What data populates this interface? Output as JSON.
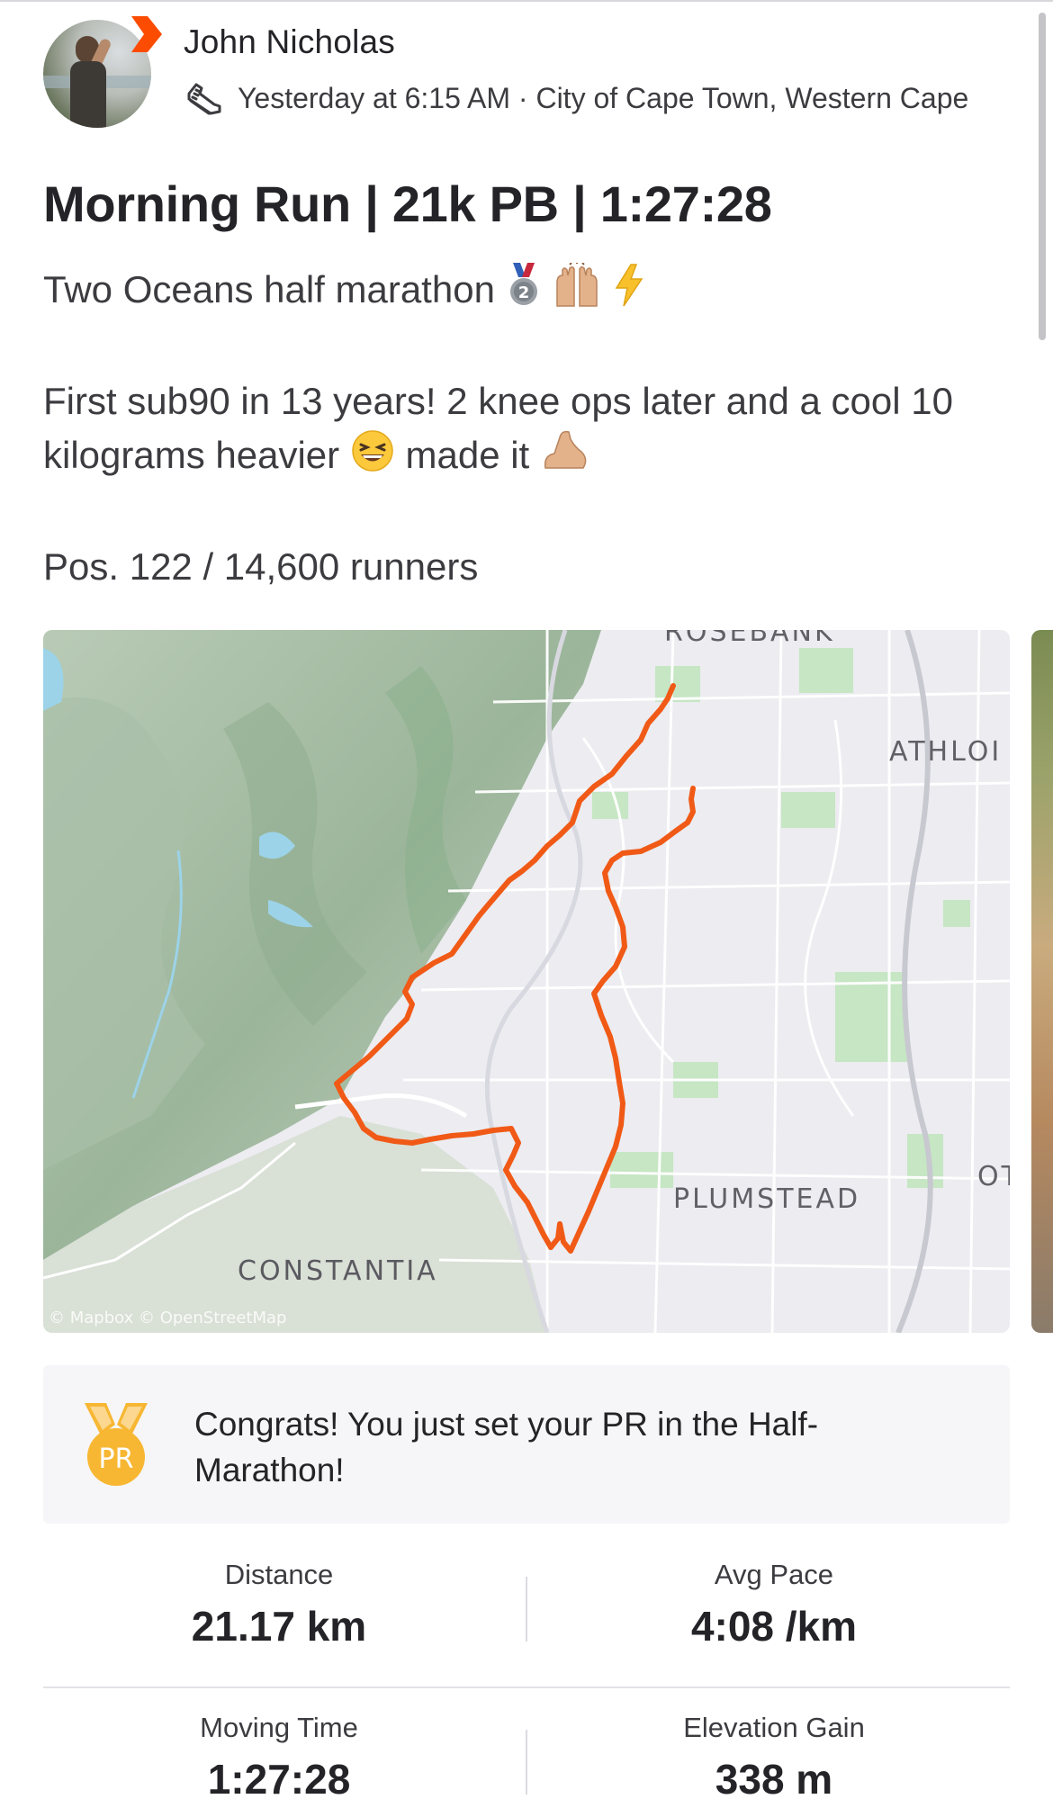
{
  "colors": {
    "accent": "#fc4c02",
    "route": "#f05a16",
    "medal": "#f7b733",
    "text": "#242428"
  },
  "athlete": {
    "name": "John Nicholas",
    "avatar_icon": "athlete-avatar",
    "badge_icon": "strava-chevron-icon"
  },
  "activity_meta": {
    "icon": "running-shoe-icon",
    "text": "Yesterday at 6:15 AM · City of Cape Town, Western Cape"
  },
  "activity": {
    "title": "Morning Run | 21k PB | 1:27:28",
    "desc_line1": "Two Oceans half marathon",
    "desc_line2a": "First sub90 in 13 years! 2 knee ops later and a cool 10 kilograms heavier",
    "desc_line2b": "made it",
    "desc_line3": "Pos. 122 / 14,600 runners"
  },
  "map": {
    "labels": {
      "rosebank": "ROSEBANK",
      "athlone": "ATHLOI",
      "plumstead": "PLUMSTEAD",
      "constantia": "CONSTANTIA",
      "ot": "OT"
    },
    "attribution": "© Mapbox © OpenStreetMap"
  },
  "achievement": {
    "medal_label": "PR",
    "text": "Congrats! You just set your PR in the Half-Marathon!"
  },
  "stats": [
    {
      "label": "Distance",
      "value": "21.17 km"
    },
    {
      "label": "Avg Pace",
      "value": "4:08 /km"
    },
    {
      "label": "Moving Time",
      "value": "1:27:28"
    },
    {
      "label": "Elevation Gain",
      "value": "338 m"
    }
  ]
}
